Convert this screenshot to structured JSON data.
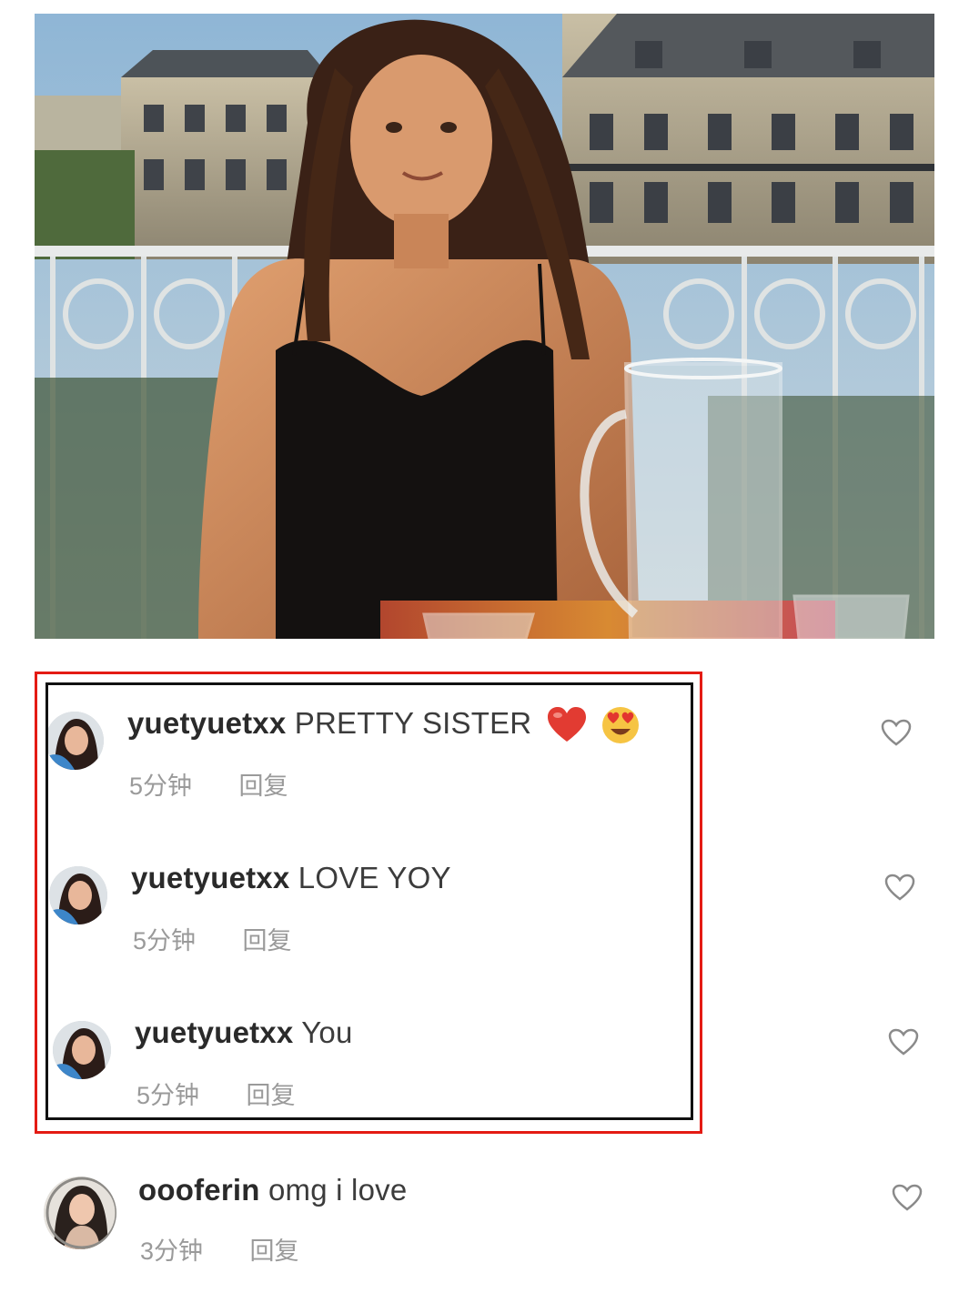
{
  "post": {
    "photo_icon": "post-photo"
  },
  "comments": [
    {
      "avatar_icon": "user-avatar",
      "username": "yuetyuetxx",
      "text": "PRETTY SISTER",
      "emojis": [
        "red-heart-emoji",
        "heart-eyes-emoji"
      ],
      "time": "5分钟",
      "reply_label": "回复",
      "like_icon": "heart-outline-icon"
    },
    {
      "avatar_icon": "user-avatar",
      "username": "yuetyuetxx",
      "text": "LOVE YOY",
      "emojis": [],
      "time": "5分钟",
      "reply_label": "回复",
      "like_icon": "heart-outline-icon"
    },
    {
      "avatar_icon": "user-avatar",
      "username": "yuetyuetxx",
      "text": "You",
      "emojis": [],
      "time": "5分钟",
      "reply_label": "回复",
      "like_icon": "heart-outline-icon"
    },
    {
      "avatar_icon": "user-avatar",
      "username": "oooferin",
      "text": "omg i love",
      "emojis": [],
      "time": "3分钟",
      "reply_label": "回复",
      "like_icon": "heart-outline-icon"
    }
  ],
  "highlight": {
    "outer_color": "#e41b14",
    "inner_color": "#111111"
  }
}
